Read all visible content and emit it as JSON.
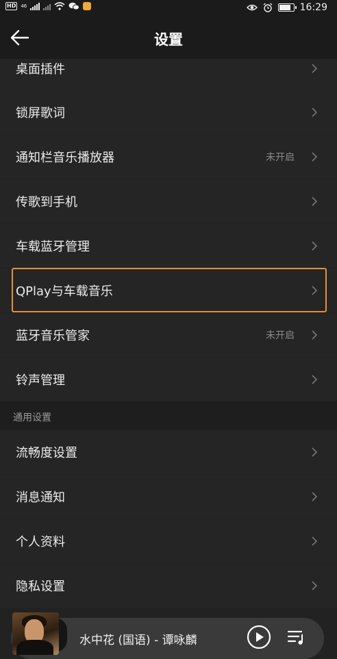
{
  "statusbar": {
    "network_label": "46",
    "time": "16:29",
    "battery_level": 0.9
  },
  "header": {
    "title": "设置"
  },
  "items_top": [
    {
      "label": "桌面插件",
      "status": ""
    },
    {
      "label": "锁屏歌词",
      "status": ""
    },
    {
      "label": "通知栏音乐播放器",
      "status": "未开启"
    },
    {
      "label": "传歌到手机",
      "status": ""
    },
    {
      "label": "车载蓝牙管理",
      "status": ""
    },
    {
      "label": "QPlay与车载音乐",
      "status": ""
    },
    {
      "label": "蓝牙音乐管家",
      "status": "未开启"
    },
    {
      "label": "铃声管理",
      "status": ""
    }
  ],
  "section_general": {
    "title": "通用设置"
  },
  "items_general": [
    {
      "label": "流畅度设置"
    },
    {
      "label": "消息通知"
    },
    {
      "label": "个人资料"
    },
    {
      "label": "隐私设置"
    }
  ],
  "player": {
    "song": "水中花 (国语) - 谭咏麟"
  },
  "colors": {
    "highlight": "#e8913a",
    "background": "#222222"
  }
}
